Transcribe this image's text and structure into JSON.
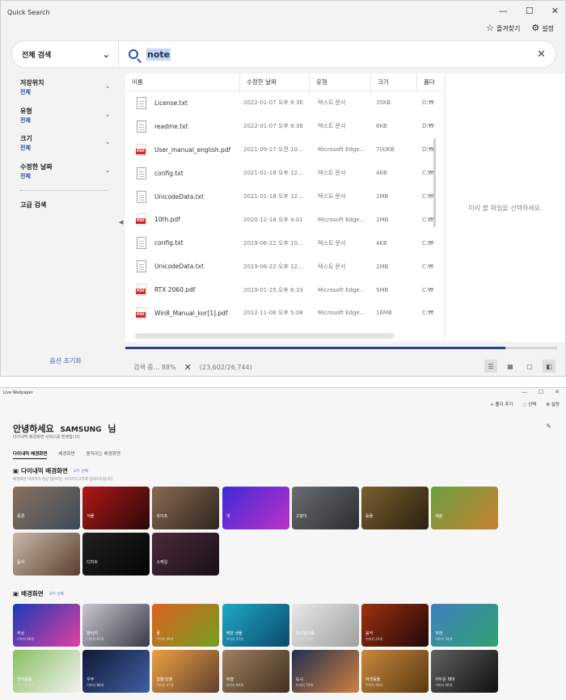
{
  "window1": {
    "title": "Quick Search",
    "top_buttons": [
      {
        "icon": "star-icon",
        "label": "즐겨찾기"
      },
      {
        "icon": "gear-icon",
        "label": "설정"
      }
    ],
    "scope_label": "전체 검색",
    "query": "note",
    "filters": [
      {
        "label": "저장위치",
        "value": "전체"
      },
      {
        "label": "유형",
        "value": "전체"
      },
      {
        "label": "크기",
        "value": "전체"
      },
      {
        "label": "수정한 날짜",
        "value": "전체"
      }
    ],
    "advanced_search": "고급 검색",
    "reset_options": "옵션 초기화",
    "columns": [
      "이름",
      "수정한 날짜",
      "유형",
      "크기",
      "폴더"
    ],
    "files": [
      {
        "name": "License.txt",
        "kind": "txt",
        "date": "2022-01-07 오후 8:36",
        "type": "텍스트 문서",
        "size": "35KB",
        "folder": "D:₩"
      },
      {
        "name": "readme.txt",
        "kind": "txt",
        "date": "2022-01-07 오후 8:36",
        "type": "텍스트 문서",
        "size": "6KB",
        "folder": "D:₩"
      },
      {
        "name": "User_manual_english.pdf",
        "kind": "pdf",
        "date": "2021-09-17 오전 10...",
        "type": "Microsoft Edge...",
        "size": "700KB",
        "folder": "D:₩"
      },
      {
        "name": "config.txt",
        "kind": "txt",
        "date": "2021-01-18 오후 12...",
        "type": "텍스트 문서",
        "size": "4KB",
        "folder": "C:₩"
      },
      {
        "name": "UnicodeData.txt",
        "kind": "txt",
        "date": "2021-01-18 오후 12...",
        "type": "텍스트 문서",
        "size": "1MB",
        "folder": "C:₩"
      },
      {
        "name": "10th.pdf",
        "kind": "pdf",
        "date": "2020-12-18 오후 4:01",
        "type": "Microsoft Edge...",
        "size": "2MB",
        "folder": "C:₩"
      },
      {
        "name": "config.txt",
        "kind": "txt",
        "date": "2019-06-22 오후 10...",
        "type": "텍스트 문서",
        "size": "4KB",
        "folder": "C:₩"
      },
      {
        "name": "UnicodeData.txt",
        "kind": "txt",
        "date": "2019-06-22 오후 12...",
        "type": "텍스트 문서",
        "size": "1MB",
        "folder": "C:₩"
      },
      {
        "name": "RTX 2060.pdf",
        "kind": "pdf",
        "date": "2019-01-25 오후 6:33",
        "type": "Microsoft Edge...",
        "size": "5MB",
        "folder": "C:₩"
      },
      {
        "name": "Win8_Manual_kor[1].pdf",
        "kind": "pdf",
        "date": "2012-11-06 오후 5:08",
        "type": "Microsoft Edge...",
        "size": "16MB",
        "folder": "C:₩"
      }
    ],
    "preview_placeholder": "미리 볼 파일을 선택하세요.",
    "status_text": "검색 중... 88%",
    "status_counts": "(23,602/26,744)",
    "progress_fraction": 0.88
  },
  "window2": {
    "title": "Live Wallpaper",
    "actions": [
      "+ 폴더 추가",
      "선택",
      "설정"
    ],
    "greeting": "안녕하세요",
    "device_name": "SAMSUNG",
    "honorific": "님",
    "subtitle": "다이내믹 배경화면 서비스를 환영합니다",
    "tabs": [
      "다이내믹 배경화면",
      "배경화면",
      "움직이는 배경화면"
    ],
    "dynamic_section": {
      "title": "다이내믹 배경화면",
      "more": "모두 선택",
      "desc": "배경화면 이미지가 정상 탭하지는 이미지가 2하여 업데이트됩니다",
      "tiles": [
        {
          "label": "풍경",
          "colors": [
            "#8a7060",
            "#3c4a5a"
          ]
        },
        {
          "label": "식물",
          "colors": [
            "#b01818",
            "#2a0808"
          ]
        },
        {
          "label": "라이프",
          "colors": [
            "#8a6a50",
            "#2e2620"
          ]
        },
        {
          "label": "개",
          "colors": [
            "#3c2bd8",
            "#c030c8"
          ]
        },
        {
          "label": "고양이",
          "colors": [
            "#6a6e70",
            "#2a2e30"
          ]
        },
        {
          "label": "동물",
          "colors": [
            "#7a6030",
            "#2a2010"
          ]
        },
        {
          "label": "예술",
          "colors": [
            "#6aa040",
            "#c88030"
          ]
        },
        {
          "label": "음식",
          "colors": [
            "#c8b8a8",
            "#5a4030"
          ]
        },
        {
          "label": "디지트",
          "colors": [
            "#202020",
            "#050505"
          ]
        },
        {
          "label": "스케일",
          "colors": [
            "#4a2a3a",
            "#1a1016"
          ]
        }
      ]
    },
    "wallpaper_section": {
      "title": "배경화면",
      "more": "모두 선택",
      "tiles": [
        {
          "label": "추상",
          "count": "이미지 86개",
          "colors": [
            "#1a3ab8",
            "#e040a0"
          ]
        },
        {
          "label": "판타지",
          "count": "이미지 85개",
          "colors": [
            "#c8c8d0",
            "#3a3a48"
          ]
        },
        {
          "label": "꽃",
          "count": "이미지 48개",
          "colors": [
            "#e06020",
            "#70a020"
          ]
        },
        {
          "label": "해양 생물",
          "count": "이미지 25개",
          "colors": [
            "#20a8c8",
            "#0a4a6a"
          ]
        },
        {
          "label": "미니멀리즘",
          "count": "이미지 30개",
          "colors": [
            "#e8e8e8",
            "#a0a0a0"
          ]
        },
        {
          "label": "음악",
          "count": "이미지 23개",
          "colors": [
            "#a03010",
            "#200808"
          ]
        },
        {
          "label": "자연",
          "count": "이미지 28개",
          "colors": [
            "#4080c0",
            "#30a070"
          ]
        },
        {
          "label": "반려동물",
          "count": "이미지 68개",
          "colors": [
            "#88c060",
            "#f0f0f0"
          ]
        },
        {
          "label": "우주",
          "count": "이미지 88개",
          "colors": [
            "#101838",
            "#4060a0"
          ]
        },
        {
          "label": "일몰/일출",
          "count": "이미지 47개",
          "colors": [
            "#f0a040",
            "#604030"
          ]
        },
        {
          "label": "여행",
          "count": "이미지 88개",
          "colors": [
            "#a08060",
            "#403020"
          ]
        },
        {
          "label": "도시",
          "count": "이미지 74개",
          "colors": [
            "#203050",
            "#d08040"
          ]
        },
        {
          "label": "야생동물",
          "count": "이미지 46개",
          "colors": [
            "#c88840",
            "#5a3a10"
          ]
        },
        {
          "label": "어두운 테마",
          "count": "이미지 46개",
          "colors": [
            "#606060",
            "#101010"
          ]
        }
      ]
    }
  }
}
